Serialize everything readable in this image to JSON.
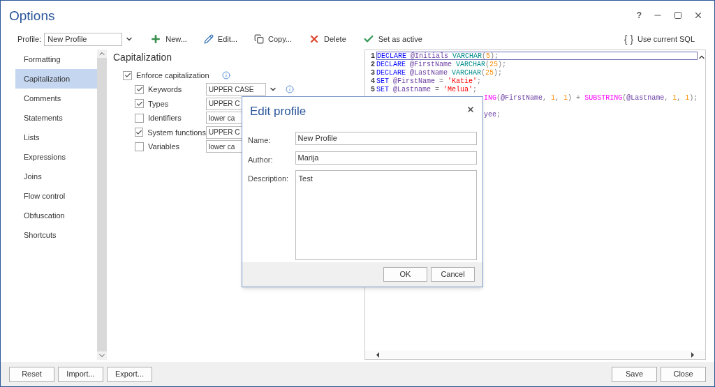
{
  "window": {
    "title": "Options",
    "help": "?"
  },
  "toolbar": {
    "profile_label": "Profile:",
    "profile_value": "New Profile",
    "actions": [
      {
        "kind": "new",
        "label": "New..."
      },
      {
        "kind": "edit",
        "label": "Edit..."
      },
      {
        "kind": "copy",
        "label": "Copy..."
      },
      {
        "kind": "delete",
        "label": "Delete"
      },
      {
        "kind": "activate",
        "label": "Set as active"
      }
    ],
    "use_sql": {
      "icon_text": "{ }",
      "label": "Use current SQL"
    }
  },
  "sidebar": {
    "items": [
      {
        "label": "Formatting",
        "selected": false
      },
      {
        "label": "Capitalization",
        "selected": true
      },
      {
        "label": "Comments",
        "selected": false
      },
      {
        "label": "Statements",
        "selected": false
      },
      {
        "label": "Lists",
        "selected": false
      },
      {
        "label": "Expressions",
        "selected": false
      },
      {
        "label": "Joins",
        "selected": false
      },
      {
        "label": "Flow control",
        "selected": false
      },
      {
        "label": "Obfuscation",
        "selected": false
      },
      {
        "label": "Shortcuts",
        "selected": false
      }
    ]
  },
  "section": {
    "title": "Capitalization",
    "enforce": {
      "label": "Enforce capitalization",
      "checked": true,
      "info": true
    },
    "rows": [
      {
        "label": "Keywords",
        "checked": true,
        "value": "UPPER CASE",
        "dropdown": true,
        "info": true
      },
      {
        "label": "Types",
        "checked": true,
        "value": "UPPER C",
        "dropdown": false,
        "info": false
      },
      {
        "label": "Identifiers",
        "checked": false,
        "value": "lower ca",
        "dropdown": false,
        "info": false
      },
      {
        "label": "System functions",
        "checked": true,
        "value": "UPPER C",
        "dropdown": false,
        "info": false
      },
      {
        "label": "Variables",
        "checked": false,
        "value": "lower ca",
        "dropdown": false,
        "info": false
      }
    ]
  },
  "editor": {
    "lines": [
      {
        "kind": "full",
        "number": "1",
        "current": true,
        "tokens": [
          {
            "kind": "keyword",
            "text": "DECLARE "
          },
          {
            "kind": "variable",
            "text": "@Initials "
          },
          {
            "kind": "type",
            "text": "VARCHAR"
          },
          {
            "kind": "punct",
            "text": "("
          },
          {
            "kind": "number",
            "text": "5"
          },
          {
            "kind": "punct",
            "text": ");"
          }
        ]
      },
      {
        "kind": "full",
        "number": "2",
        "current": false,
        "tokens": [
          {
            "kind": "keyword",
            "text": "DECLARE "
          },
          {
            "kind": "variable",
            "text": "@FirstName "
          },
          {
            "kind": "type",
            "text": "VARCHAR"
          },
          {
            "kind": "punct",
            "text": "("
          },
          {
            "kind": "number",
            "text": "25"
          },
          {
            "kind": "punct",
            "text": ");"
          }
        ]
      },
      {
        "kind": "full",
        "number": "3",
        "current": false,
        "tokens": [
          {
            "kind": "keyword",
            "text": "DECLARE "
          },
          {
            "kind": "variable",
            "text": "@LastName "
          },
          {
            "kind": "type",
            "text": "VARCHAR"
          },
          {
            "kind": "punct",
            "text": "("
          },
          {
            "kind": "number",
            "text": "25"
          },
          {
            "kind": "punct",
            "text": ");"
          }
        ]
      },
      {
        "kind": "full",
        "number": "4",
        "current": false,
        "tokens": [
          {
            "kind": "keyword",
            "text": "SET "
          },
          {
            "kind": "variable",
            "text": "@FirstName "
          },
          {
            "kind": "punct",
            "text": "= "
          },
          {
            "kind": "string",
            "text": "'Katie'"
          },
          {
            "kind": "punct",
            "text": ";"
          }
        ]
      },
      {
        "kind": "full",
        "number": "5",
        "current": false,
        "tokens": [
          {
            "kind": "keyword",
            "text": "SET "
          },
          {
            "kind": "variable",
            "text": "@Lastname "
          },
          {
            "kind": "punct",
            "text": "= "
          },
          {
            "kind": "string",
            "text": "'Melua'"
          },
          {
            "kind": "punct",
            "text": ";"
          }
        ]
      },
      {
        "kind": "partial",
        "current": false,
        "tokens": [
          {
            "kind": "function",
            "text": "ING"
          },
          {
            "kind": "punct",
            "text": "("
          },
          {
            "kind": "variable",
            "text": "@FirstName"
          },
          {
            "kind": "punct",
            "text": ", "
          },
          {
            "kind": "number",
            "text": "1"
          },
          {
            "kind": "punct",
            "text": ", "
          },
          {
            "kind": "number",
            "text": "1"
          },
          {
            "kind": "punct",
            "text": ") + "
          },
          {
            "kind": "function",
            "text": "SUBSTRING"
          },
          {
            "kind": "punct",
            "text": "("
          },
          {
            "kind": "variable",
            "text": "@Lastname"
          },
          {
            "kind": "punct",
            "text": ", "
          },
          {
            "kind": "number",
            "text": "1"
          },
          {
            "kind": "punct",
            "text": ", "
          },
          {
            "kind": "number",
            "text": "1"
          },
          {
            "kind": "punct",
            "text": ");"
          }
        ]
      },
      {
        "kind": "blank"
      },
      {
        "kind": "partial",
        "current": false,
        "tokens": [
          {
            "kind": "variable",
            "text": "yee"
          },
          {
            "kind": "punct",
            "text": ";"
          }
        ]
      }
    ]
  },
  "dialog": {
    "title": "Edit profile",
    "fields": [
      {
        "kind": "line",
        "label": "Name:",
        "value": "New Profile"
      },
      {
        "kind": "line",
        "label": "Author:",
        "value": "Marija"
      },
      {
        "kind": "area",
        "label": "Description:",
        "value": "Test"
      }
    ],
    "buttons": [
      "OK",
      "Cancel"
    ]
  },
  "footer": {
    "left_buttons": [
      "Reset",
      "Import...",
      "Export..."
    ],
    "right_buttons": [
      "Save",
      "Close"
    ]
  }
}
